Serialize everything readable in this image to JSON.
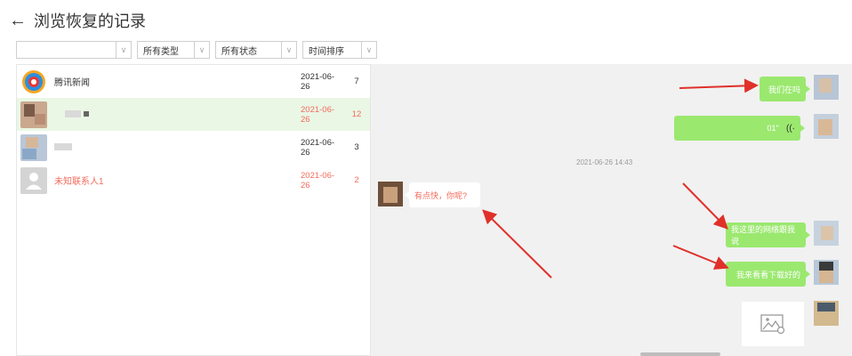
{
  "header": {
    "back_icon": "←",
    "title": "浏览恢复的记录"
  },
  "filters": {
    "contact_select": "",
    "type_select": "所有类型",
    "status_select": "所有状态",
    "sort_select": "时间排序"
  },
  "contacts": [
    {
      "name": "腾讯新闻",
      "date": "2021-06-26",
      "count": "7"
    },
    {
      "name": "",
      "date": "2021-06-26",
      "count": "12"
    },
    {
      "name": "",
      "date": "2021-06-26",
      "count": "3"
    },
    {
      "name": "未知联系人1",
      "date": "2021-06-26",
      "count": "2"
    }
  ],
  "chat": {
    "msg1": "我们在吗",
    "voice_duration": "01''",
    "timestamp": "2021-06-26 14:43",
    "msg_left": "有点快，你呢?",
    "msg3": "我这里的网络跟我说",
    "msg4": "我来看看下载好的"
  },
  "colors": {
    "bubble_green": "#9be86f",
    "selected_row": "#eaf7e5",
    "red_text": "#f36b5c",
    "arrow": "#e0302a"
  }
}
